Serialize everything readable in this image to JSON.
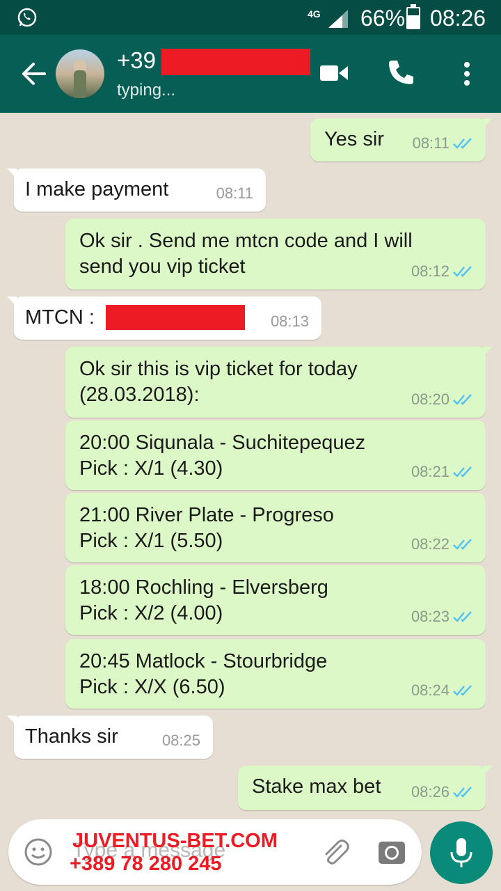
{
  "status_bar": {
    "network": "4G",
    "battery": "66%",
    "time": "08:26"
  },
  "header": {
    "contact_number": "+39",
    "contact_status": "typing..."
  },
  "messages": [
    {
      "dir": "out",
      "text": "Yes sir",
      "time": "08:11"
    },
    {
      "dir": "in",
      "text": "I make payment",
      "time": "08:11"
    },
    {
      "dir": "out",
      "text": "Ok sir . Send me mtcn code and I will\nsend you vip ticket",
      "time": "08:12"
    },
    {
      "dir": "in",
      "text": "MTCN :",
      "time": "08:13"
    },
    {
      "dir": "out",
      "text": "Ok sir this is vip ticket for today\n(28.03.2018):",
      "time": "08:20"
    },
    {
      "dir": "out",
      "text": "20:00 Siqunala - Suchitepequez\nPick : X/1 (4.30)",
      "time": "08:21"
    },
    {
      "dir": "out",
      "text": "21:00 River Plate - Progreso\nPick : X/1 (5.50)",
      "time": "08:22"
    },
    {
      "dir": "out",
      "text": "18:00 Rochling - Elversberg\nPick : X/2 (4.00)",
      "time": "08:23"
    },
    {
      "dir": "out",
      "text": "20:45 Matlock  - Stourbridge\nPick : X/X (6.50)",
      "time": "08:24"
    },
    {
      "dir": "in",
      "text": "Thanks sir",
      "time": "08:25"
    },
    {
      "dir": "out",
      "text": "Stake max bet",
      "time": "08:26"
    }
  ],
  "composer": {
    "placeholder": "Type a message"
  },
  "watermark": {
    "line1": "JUVENTUS-BET.COM",
    "line2": "+389 78 280 245"
  },
  "colors": {
    "header": "#075e54",
    "outgoing_bubble": "#dcf8c6",
    "read_tick": "#4fc3f7",
    "redaction": "#ed1c24"
  }
}
